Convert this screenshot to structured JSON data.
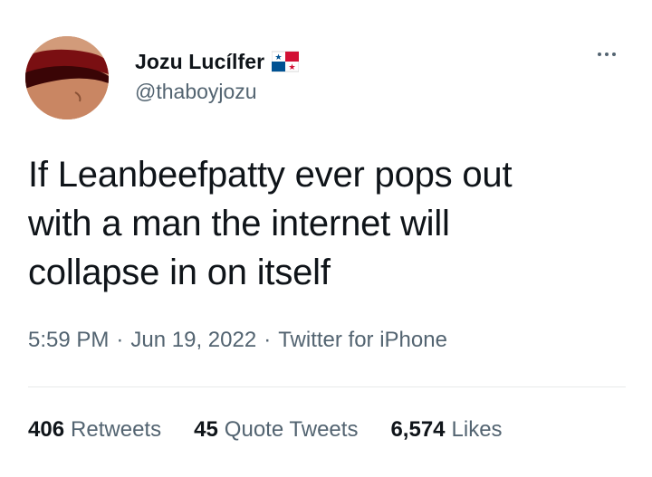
{
  "author": {
    "display_name": "Jozu Lucílfer",
    "handle": "@thaboyjozu",
    "flag_icon": "panama-flag-icon"
  },
  "tweet": {
    "text": "If Leanbeefpatty ever pops out\nwith a man the internet will\ncollapse in on itself"
  },
  "meta": {
    "time": "5:59 PM",
    "date": "Jun 19, 2022",
    "source": "Twitter for iPhone",
    "separator": "·"
  },
  "stats": {
    "retweets": {
      "count": "406",
      "label": "Retweets"
    },
    "quote_tweets": {
      "count": "45",
      "label": "Quote Tweets"
    },
    "likes": {
      "count": "6,574",
      "label": "Likes"
    }
  },
  "colors": {
    "text_primary": "#0f1419",
    "text_secondary": "#536471",
    "divider": "#e7e9ea",
    "flag_red": "#d21034",
    "flag_blue": "#005293"
  }
}
